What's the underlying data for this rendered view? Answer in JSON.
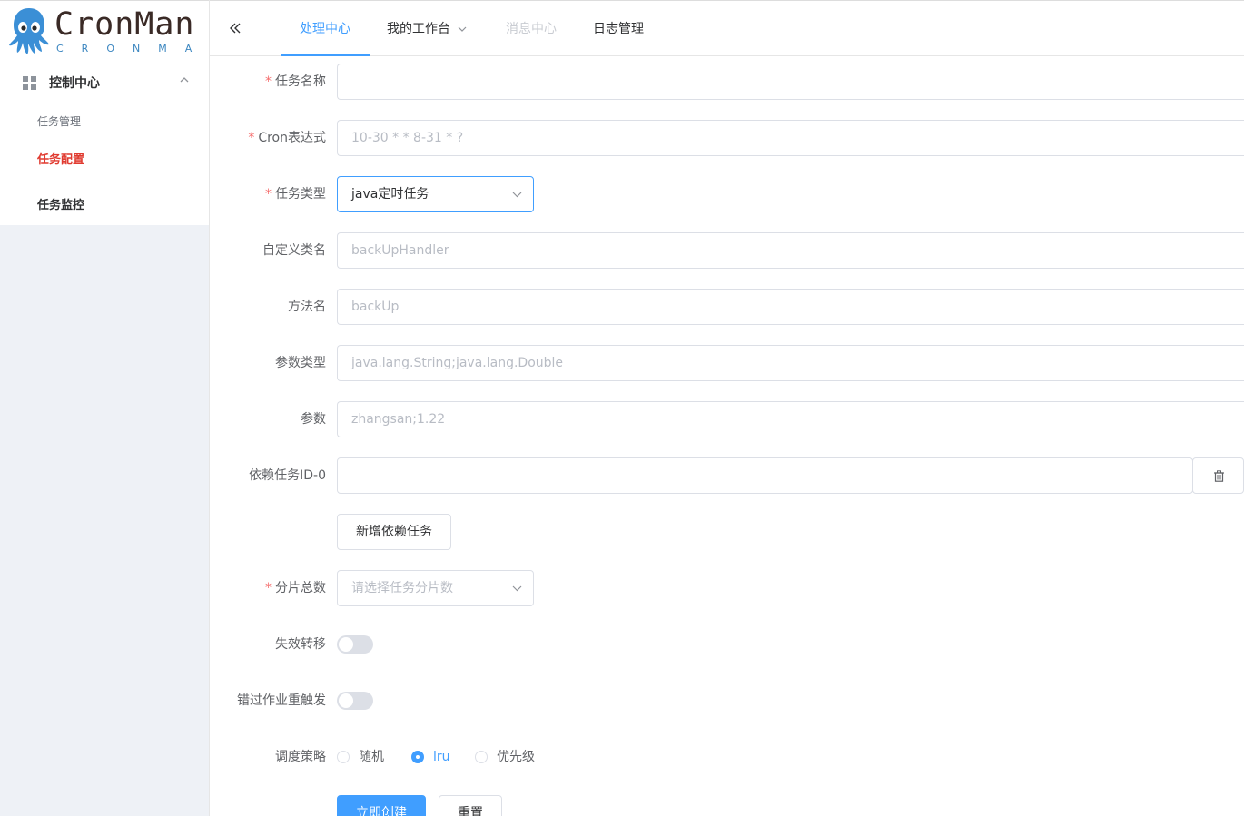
{
  "logo": {
    "title": "CronMan",
    "subtitle": "CRONMAN"
  },
  "sidebar": {
    "group_label": "控制中心",
    "items": [
      {
        "label": "任务管理"
      },
      {
        "label": "任务配置"
      },
      {
        "label": "任务监控"
      }
    ]
  },
  "header": {
    "tabs": [
      {
        "label": "处理中心"
      },
      {
        "label": "我的工作台"
      },
      {
        "label": "消息中心"
      },
      {
        "label": "日志管理"
      }
    ]
  },
  "form": {
    "task_name": {
      "label": "任务名称",
      "value": ""
    },
    "cron": {
      "label": "Cron表达式",
      "placeholder": "10-30 * * 8-31 * ?"
    },
    "task_type": {
      "label": "任务类型",
      "value": "java定时任务"
    },
    "class_name": {
      "label": "自定义类名",
      "placeholder": "backUpHandler"
    },
    "method_name": {
      "label": "方法名",
      "placeholder": "backUp"
    },
    "param_types": {
      "label": "参数类型",
      "placeholder": "java.lang.String;java.lang.Double"
    },
    "params": {
      "label": "参数",
      "placeholder": "zhangsan;1.22"
    },
    "dependency": {
      "label": "依赖任务ID-0",
      "value": ""
    },
    "add_dependency_label": "新增依赖任务",
    "shard_total": {
      "label": "分片总数",
      "placeholder": "请选择任务分片数"
    },
    "failover": {
      "label": "失效转移",
      "on": false
    },
    "misfire": {
      "label": "错过作业重触发",
      "on": false
    },
    "strategy": {
      "label": "调度策略",
      "options": [
        "随机",
        "lru",
        "优先级"
      ],
      "selected": "lru"
    },
    "submit_label": "立即创建",
    "reset_label": "重置"
  },
  "colors": {
    "primary": "#409eff",
    "danger": "#f56c6c",
    "active_menu": "#e03a2f",
    "sidebar_bg": "#eef1f6"
  },
  "icons": [
    "octopus-mascot-icon",
    "grid-icon",
    "chevron-up-icon",
    "double-chevron-left-icon",
    "chevron-down-icon",
    "trash-icon"
  ]
}
